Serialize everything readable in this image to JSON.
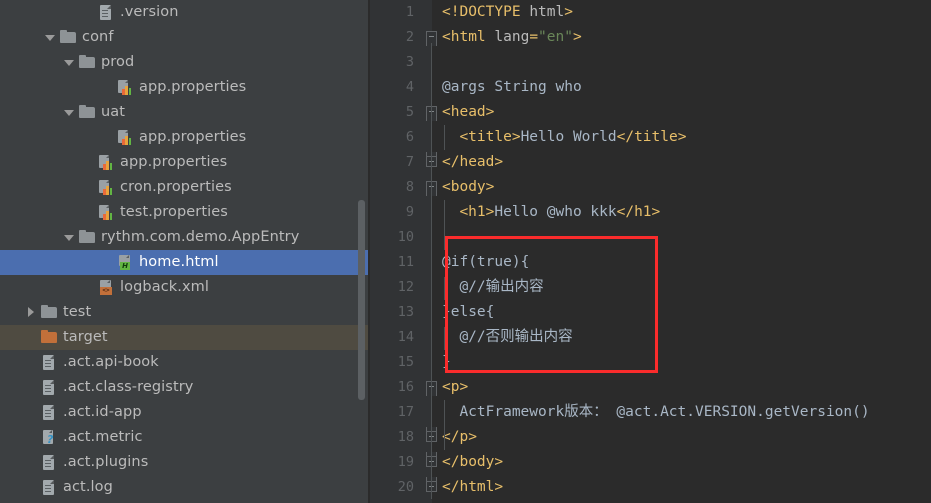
{
  "sidebar": {
    "scrollbar": "vertical-scrollbar",
    "items": [
      {
        "label": ".version",
        "indent": 4,
        "arrow": "none",
        "icon": "file-icon",
        "state": "normal"
      },
      {
        "label": "conf",
        "indent": 2,
        "arrow": "down",
        "icon": "folder-icon",
        "state": "normal"
      },
      {
        "label": "prod",
        "indent": 3,
        "arrow": "down",
        "icon": "folder-icon",
        "state": "normal"
      },
      {
        "label": "app.properties",
        "indent": 5,
        "arrow": "none",
        "icon": "properties-icon",
        "state": "normal"
      },
      {
        "label": "uat",
        "indent": 3,
        "arrow": "down",
        "icon": "folder-icon",
        "state": "normal"
      },
      {
        "label": "app.properties",
        "indent": 5,
        "arrow": "none",
        "icon": "properties-icon",
        "state": "normal"
      },
      {
        "label": "app.properties",
        "indent": 4,
        "arrow": "none",
        "icon": "properties-icon",
        "state": "normal"
      },
      {
        "label": "cron.properties",
        "indent": 4,
        "arrow": "none",
        "icon": "properties-icon",
        "state": "normal"
      },
      {
        "label": "test.properties",
        "indent": 4,
        "arrow": "none",
        "icon": "properties-icon",
        "state": "normal"
      },
      {
        "label": "rythm.com.demo.AppEntry",
        "indent": 3,
        "arrow": "down",
        "icon": "folder-icon",
        "state": "normal"
      },
      {
        "label": "home.html",
        "indent": 5,
        "arrow": "none",
        "icon": "html-file-icon",
        "state": "selected"
      },
      {
        "label": "logback.xml",
        "indent": 4,
        "arrow": "none",
        "icon": "xml-file-icon",
        "state": "normal"
      },
      {
        "label": "test",
        "indent": 1,
        "arrow": "right",
        "icon": "folder-icon",
        "state": "normal"
      },
      {
        "label": "target",
        "indent": 1,
        "arrow": "none",
        "icon": "folder-icon-orange",
        "state": "context"
      },
      {
        "label": ".act.api-book",
        "indent": 1,
        "arrow": "none",
        "icon": "file-icon",
        "state": "normal"
      },
      {
        "label": ".act.class-registry",
        "indent": 1,
        "arrow": "none",
        "icon": "file-icon",
        "state": "normal"
      },
      {
        "label": ".act.id-app",
        "indent": 1,
        "arrow": "none",
        "icon": "file-icon",
        "state": "normal"
      },
      {
        "label": ".act.metric",
        "indent": 1,
        "arrow": "none",
        "icon": "unknown-file-icon",
        "state": "normal"
      },
      {
        "label": ".act.plugins",
        "indent": 1,
        "arrow": "none",
        "icon": "file-icon",
        "state": "normal"
      },
      {
        "label": "act.log",
        "indent": 1,
        "arrow": "none",
        "icon": "file-icon",
        "state": "normal"
      }
    ]
  },
  "editor": {
    "filename": "home.html",
    "lines": [
      {
        "n": "1",
        "fold": "none",
        "indent": 0,
        "tokens": [
          {
            "t": "<!DOCTYPE ",
            "c": "t-doc"
          },
          {
            "t": "html",
            "c": "t-attr"
          },
          {
            "t": ">",
            "c": "t-br"
          }
        ]
      },
      {
        "n": "2",
        "fold": "open",
        "indent": 0,
        "tokens": [
          {
            "t": "<",
            "c": "t-br"
          },
          {
            "t": "html",
            "c": "t-tagname"
          },
          {
            "t": " ",
            "c": "t-txt"
          },
          {
            "t": "lang",
            "c": "t-attr"
          },
          {
            "t": "=",
            "c": "t-br"
          },
          {
            "t": "\"en\"",
            "c": "t-str"
          },
          {
            "t": ">",
            "c": "t-br"
          }
        ]
      },
      {
        "n": "3",
        "fold": "none",
        "indent": 0,
        "tokens": []
      },
      {
        "n": "4",
        "fold": "none",
        "indent": 0,
        "tokens": [
          {
            "t": "@args String who",
            "c": "t-rythm"
          }
        ]
      },
      {
        "n": "5",
        "fold": "open",
        "indent": 0,
        "tokens": [
          {
            "t": "<",
            "c": "t-br"
          },
          {
            "t": "head",
            "c": "t-tagname"
          },
          {
            "t": ">",
            "c": "t-br"
          }
        ]
      },
      {
        "n": "6",
        "fold": "none",
        "indent": 1,
        "tokens": [
          {
            "t": "<",
            "c": "t-br"
          },
          {
            "t": "title",
            "c": "t-tagname"
          },
          {
            "t": ">",
            "c": "t-br"
          },
          {
            "t": "Hello World",
            "c": "t-txt"
          },
          {
            "t": "</",
            "c": "t-br"
          },
          {
            "t": "title",
            "c": "t-tagname"
          },
          {
            "t": ">",
            "c": "t-br"
          }
        ]
      },
      {
        "n": "7",
        "fold": "close",
        "indent": 0,
        "tokens": [
          {
            "t": "</",
            "c": "t-br"
          },
          {
            "t": "head",
            "c": "t-tagname"
          },
          {
            "t": ">",
            "c": "t-br"
          }
        ]
      },
      {
        "n": "8",
        "fold": "open",
        "indent": 0,
        "tokens": [
          {
            "t": "<",
            "c": "t-br"
          },
          {
            "t": "body",
            "c": "t-tagname"
          },
          {
            "t": ">",
            "c": "t-br"
          }
        ]
      },
      {
        "n": "9",
        "fold": "none",
        "indent": 1,
        "tokens": [
          {
            "t": "<",
            "c": "t-br"
          },
          {
            "t": "h1",
            "c": "t-tagname"
          },
          {
            "t": ">",
            "c": "t-br"
          },
          {
            "t": "Hello @who kkk",
            "c": "t-txt"
          },
          {
            "t": "</",
            "c": "t-br"
          },
          {
            "t": "h1",
            "c": "t-tagname"
          },
          {
            "t": ">",
            "c": "t-br"
          }
        ]
      },
      {
        "n": "10",
        "fold": "none",
        "indent": 0,
        "tokens": []
      },
      {
        "n": "11",
        "fold": "none",
        "indent": 0,
        "tokens": [
          {
            "t": "@if(true){",
            "c": "t-rythm"
          }
        ]
      },
      {
        "n": "12",
        "fold": "none",
        "indent": 1,
        "tokens": [
          {
            "t": "@//输出内容",
            "c": "t-rythm"
          }
        ]
      },
      {
        "n": "13",
        "fold": "none",
        "indent": 0,
        "tokens": [
          {
            "t": "}else{",
            "c": "t-rythm"
          }
        ]
      },
      {
        "n": "14",
        "fold": "none",
        "indent": 1,
        "tokens": [
          {
            "t": "@//否则输出内容",
            "c": "t-rythm"
          }
        ]
      },
      {
        "n": "15",
        "fold": "none",
        "indent": 0,
        "tokens": [
          {
            "t": "}",
            "c": "t-rythm"
          }
        ]
      },
      {
        "n": "16",
        "fold": "open",
        "indent": 0,
        "tokens": [
          {
            "t": "<",
            "c": "t-br"
          },
          {
            "t": "p",
            "c": "t-tagname"
          },
          {
            "t": ">",
            "c": "t-br"
          }
        ]
      },
      {
        "n": "17",
        "fold": "none",
        "indent": 1,
        "tokens": [
          {
            "t": "ActFramework版本：",
            "c": "t-txt"
          },
          {
            "t": " @act.Act.VERSION.getVersion()",
            "c": "t-rythm"
          }
        ]
      },
      {
        "n": "18",
        "fold": "close",
        "indent": 0,
        "tokens": [
          {
            "t": "</",
            "c": "t-br"
          },
          {
            "t": "p",
            "c": "t-tagname"
          },
          {
            "t": ">",
            "c": "t-br"
          }
        ]
      },
      {
        "n": "19",
        "fold": "close",
        "indent": 0,
        "tokens": [
          {
            "t": "</",
            "c": "t-br"
          },
          {
            "t": "body",
            "c": "t-tagname"
          },
          {
            "t": ">",
            "c": "t-br"
          }
        ]
      },
      {
        "n": "20",
        "fold": "close",
        "indent": 0,
        "tokens": [
          {
            "t": "</",
            "c": "t-br"
          },
          {
            "t": "html",
            "c": "t-tagname"
          },
          {
            "t": ">",
            "c": "t-br"
          }
        ]
      }
    ],
    "annotation": {
      "name": "red-highlight-box",
      "color": "#fb2c2c",
      "covers_lines": [
        "11",
        "12",
        "13",
        "14",
        "15"
      ]
    }
  },
  "colors": {
    "sidebar_bg": "#3c3f41",
    "editor_bg": "#2b2b2b",
    "gutter_bg": "#313335",
    "selection": "#4b6eaf",
    "context_row": "#4f4b41",
    "accent_red": "#fb2c2c",
    "tag_orange": "#e8bf6a",
    "string_green": "#6a8759",
    "text_grey": "#a9b7c6"
  }
}
